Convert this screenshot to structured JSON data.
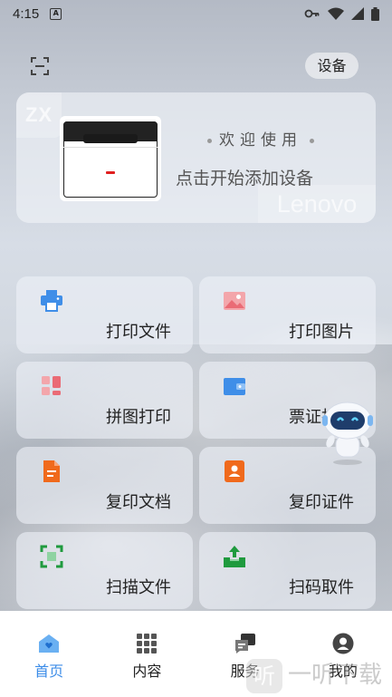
{
  "status_bar": {
    "time": "4:15",
    "notification_glyph": "A",
    "icons": [
      "key-icon",
      "wifi-icon",
      "signal-icon",
      "battery-icon"
    ]
  },
  "header": {
    "scan_icon": "scan-icon",
    "device_button_label": "设备"
  },
  "welcome_card": {
    "title": "欢迎使用",
    "subtitle": "点击开始添加设备",
    "badge_text": "ZX",
    "brand_watermark": "Lenovo"
  },
  "tiles": [
    {
      "label": "打印文件",
      "icon": "printer-icon",
      "color": "#3f8ee8"
    },
    {
      "label": "打印图片",
      "icon": "image-icon",
      "color": "#f07f86"
    },
    {
      "label": "拼图打印",
      "icon": "collage-icon",
      "color": "#f07f86"
    },
    {
      "label": "票证打印",
      "icon": "wallet-icon",
      "color": "#3f8ee8"
    },
    {
      "label": "复印文档",
      "icon": "document-icon",
      "color": "#f06a1c"
    },
    {
      "label": "复印证件",
      "icon": "id-card-icon",
      "color": "#f06a1c"
    },
    {
      "label": "扫描文件",
      "icon": "scan-frame-icon",
      "color": "#1f9a3e"
    },
    {
      "label": "扫码取件",
      "icon": "upload-tray-icon",
      "color": "#1f9a3e"
    }
  ],
  "bottom_nav": {
    "items": [
      {
        "label": "首页",
        "icon": "home-icon",
        "active": true
      },
      {
        "label": "内容",
        "icon": "grid-icon",
        "active": false
      },
      {
        "label": "服务",
        "icon": "chat-icon",
        "active": false
      },
      {
        "label": "我的",
        "icon": "user-icon",
        "active": false
      }
    ],
    "active_color": "#3d8de8"
  },
  "watermark": {
    "logo_char": "听",
    "text": "一听下载"
  }
}
